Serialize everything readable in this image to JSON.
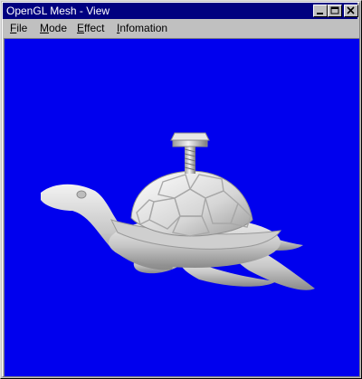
{
  "window": {
    "title": "OpenGL Mesh - View"
  },
  "menu": {
    "items": [
      {
        "id": "file",
        "underline": "F",
        "rest": "ile"
      },
      {
        "id": "mode",
        "underline": "M",
        "rest": "ode"
      },
      {
        "id": "effect",
        "underline": "E",
        "rest": "ffect"
      },
      {
        "id": "infomation",
        "underline": "I",
        "rest": "nfomation"
      }
    ]
  },
  "viewport": {
    "background_color": "#0000ee",
    "model": "turtle-with-screw-mesh"
  }
}
